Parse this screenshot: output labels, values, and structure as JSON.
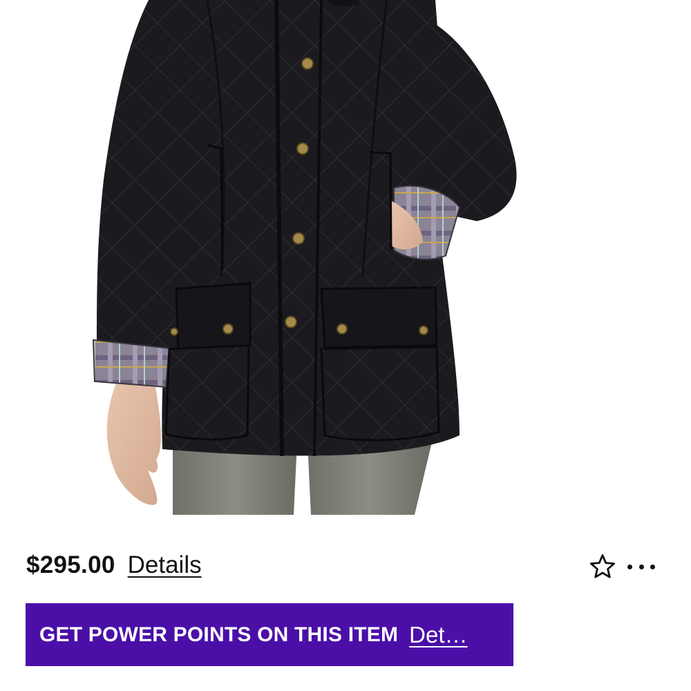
{
  "product": {
    "image_alt": "Black quilted jacket with plaid lining",
    "price": "$295.00",
    "details_label": "Details"
  },
  "actions": {
    "favorite_icon": "star-outline-icon",
    "more_icon": "more-horizontal-icon"
  },
  "banner": {
    "text": "GET POWER POINTS ON THIS ITEM",
    "link_label": "Det…",
    "background_color": "#4b0fa8"
  }
}
